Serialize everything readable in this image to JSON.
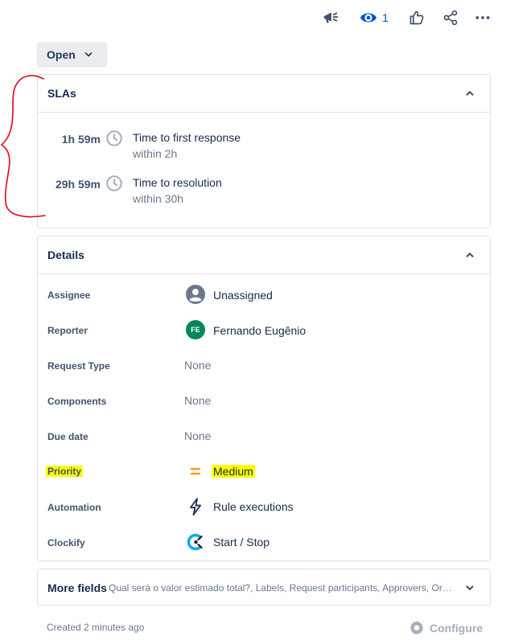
{
  "toolbar": {
    "watch_count": "1",
    "icons": [
      "megaphone-icon",
      "eye-icon",
      "thumbs-up-icon",
      "share-icon",
      "more-icon"
    ]
  },
  "status": {
    "label": "Open"
  },
  "sla": {
    "title": "SLAs",
    "items": [
      {
        "time": "1h 59m",
        "name": "Time to first response",
        "goal": "within 2h"
      },
      {
        "time": "29h 59m",
        "name": "Time to resolution",
        "goal": "within 30h"
      }
    ]
  },
  "details": {
    "title": "Details",
    "assignee": {
      "label": "Assignee",
      "value": "Unassigned"
    },
    "reporter": {
      "label": "Reporter",
      "value": "Fernando Eugênio",
      "initials": "FE"
    },
    "request_type": {
      "label": "Request Type",
      "value": "None"
    },
    "components": {
      "label": "Components",
      "value": "None"
    },
    "due_date": {
      "label": "Due date",
      "value": "None"
    },
    "priority": {
      "label": "Priority",
      "value": "Medium"
    },
    "automation": {
      "label": "Automation",
      "value": "Rule executions"
    },
    "clockify": {
      "label": "Clockify",
      "value": "Start / Stop"
    }
  },
  "more_fields": {
    "title": "More fields",
    "summary": "Qual será o valor estimado total?, Labels, Request participants, Approvers, Organizations"
  },
  "footer": {
    "created": "Created 2 minutes ago",
    "configure": "Configure"
  },
  "colors": {
    "highlight": "#ffff00",
    "priority_medium": "#ff991f",
    "annotation_red": "#e5001c",
    "reporter_avatar": "#00875a",
    "link_blue": "#0052cc"
  }
}
